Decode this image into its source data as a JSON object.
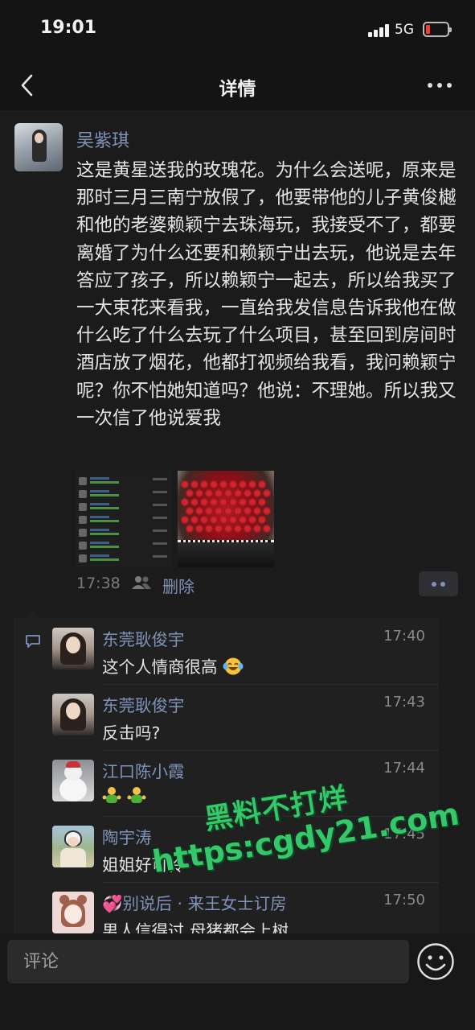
{
  "status_bar": {
    "time": "19:01",
    "network": "5G"
  },
  "nav": {
    "title": "详情"
  },
  "post": {
    "author": "吴紫琪",
    "text": "这是黄星送我的玫瑰花。为什么会送呢，原来是那时三月三南宁放假了，他要带他的儿子黄俊樾和他的老婆赖颖宁去珠海玩，我接受不了，都要离婚了为什么还要和赖颖宁出去玩，他说是去年答应了孩子，所以赖颖宁一起去，所以给我买了一大束花来看我，一直给我发信息告诉我他在做什么吃了什么去玩了什么项目，甚至回到房间时酒店放了烟花，他都打视频给我看，我问赖颖宁呢？你不怕她知道吗？他说：不理她。所以我又一次信了他说爱我",
    "time": "17:38",
    "delete_label": "删除"
  },
  "comments": [
    {
      "name": "东莞耿俊宇",
      "time": "17:40",
      "text": "这个人情商很高",
      "emoji": "laughing-tears"
    },
    {
      "name": "东莞耿俊宇",
      "time": "17:43",
      "text": "反击吗?"
    },
    {
      "name": "江口陈小霞",
      "time": "17:44",
      "text": "",
      "emoji": "two-green-figures"
    },
    {
      "name": "陶宇涛",
      "time": "17:45",
      "text": "姐姐好可怜"
    },
    {
      "name": "别说后 · 来王女士订房",
      "name_prefix": "💞",
      "time": "17:50",
      "text": "男人信得过 母猪都会上树"
    }
  ],
  "watermark": {
    "line1": "黑料不打烊",
    "line2": "https:cgdy21.com"
  },
  "comment_input": {
    "placeholder": "评论"
  },
  "colors": {
    "background": "#141414",
    "name_link": "#7f93b8",
    "watermark": "#35c86a"
  }
}
